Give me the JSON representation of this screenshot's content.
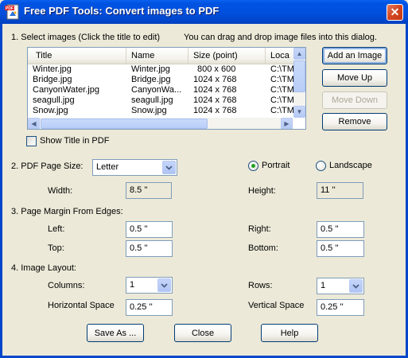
{
  "window": {
    "title": "Free PDF Tools: Convert images to PDF",
    "close_glyph": "✕"
  },
  "section1": {
    "label": "1. Select images (Click the title to edit)",
    "hint": "You can drag and drop image files into this dialog."
  },
  "list": {
    "columns": [
      "Title",
      "Name",
      "Size (point)",
      "Loca"
    ],
    "rows": [
      [
        "Winter.jpg",
        "Winter.jpg",
        "800 x  600",
        "C:\\TM"
      ],
      [
        "Bridge.jpg",
        "Bridge.jpg",
        "1024 x  768",
        "C:\\TM"
      ],
      [
        "CanyonWater.jpg",
        "CanyonWa...",
        "1024 x  768",
        "C:\\TM"
      ],
      [
        "seagull.jpg",
        "seagull.jpg",
        "1024 x  768",
        "C:\\TM"
      ],
      [
        "Snow.jpg",
        "Snow.jpg",
        "1024 x  768",
        "C:\\TM"
      ]
    ]
  },
  "buttons": {
    "add_image": "Add an Image",
    "move_up": "Move Up",
    "move_down": "Move Down",
    "remove": "Remove",
    "save_as": "Save As ...",
    "close": "Close",
    "help": "Help"
  },
  "show_title": {
    "label": "Show Title in PDF",
    "checked": false
  },
  "page_size": {
    "label": "2. PDF Page Size:",
    "selected": "Letter",
    "orientation_portrait": "Portrait",
    "orientation_landscape": "Landscape",
    "orientation_selected": "Portrait",
    "width_label": "Width:",
    "width_value": "8.5 ''",
    "height_label": "Height:",
    "height_value": "11 ''"
  },
  "margins": {
    "label": "3. Page Margin From Edges:",
    "left_label": "Left:",
    "left_value": "0.5 ''",
    "right_label": "Right:",
    "right_value": "0.5 ''",
    "top_label": "Top:",
    "top_value": "0.5 ''",
    "bottom_label": "Bottom:",
    "bottom_value": "0.5 ''"
  },
  "layout": {
    "label": "4. Image Layout:",
    "columns_label": "Columns:",
    "columns_value": "1",
    "rows_label": "Rows:",
    "rows_value": "1",
    "hspace_label": "Horizontal Space",
    "hspace_value": "0.25 ''",
    "vspace_label": "Vertical Space",
    "vspace_value": "0.25 ''"
  },
  "colors": {
    "titlebar": "#0050DE",
    "dialog_bg": "#ECE9D8",
    "selected_radio": "#21A121",
    "close_button": "#D4441F"
  }
}
